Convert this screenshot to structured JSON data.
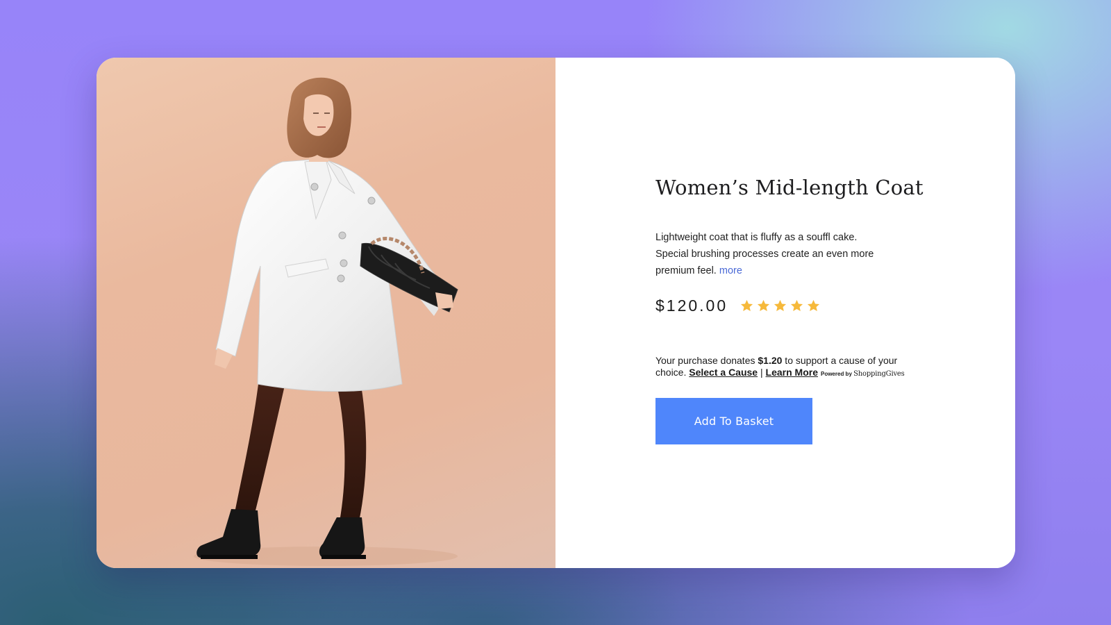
{
  "product": {
    "title": "Women’s Mid-length Coat",
    "description_lines": [
      "Lightweight coat that is fluffy as a souffl cake.",
      "Special brushing processes create an even more",
      "premium feel."
    ],
    "more_label": "more",
    "price": "$120.00",
    "rating": 5,
    "rating_max": 5,
    "star_icon": "star-icon",
    "star_color": "#f6b93b"
  },
  "donation": {
    "text_before": "Your purchase donates ",
    "amount": "$1.20",
    "text_after": " to support a cause of your",
    "text_line2": "choice. ",
    "select_cause_label": "Select a Cause",
    "separator": " | ",
    "learn_more_label": "Learn More",
    "powered_prefix": "Powered by ",
    "powered_brand": "ShoppingGives"
  },
  "actions": {
    "add_to_basket_label": "Add To Basket",
    "button_color": "#4f86fb"
  },
  "colors": {
    "background_purple": "#9784f9",
    "background_teal": "#2c5f74",
    "photo_background": "#eab99e",
    "link_color": "#4a69d6"
  }
}
